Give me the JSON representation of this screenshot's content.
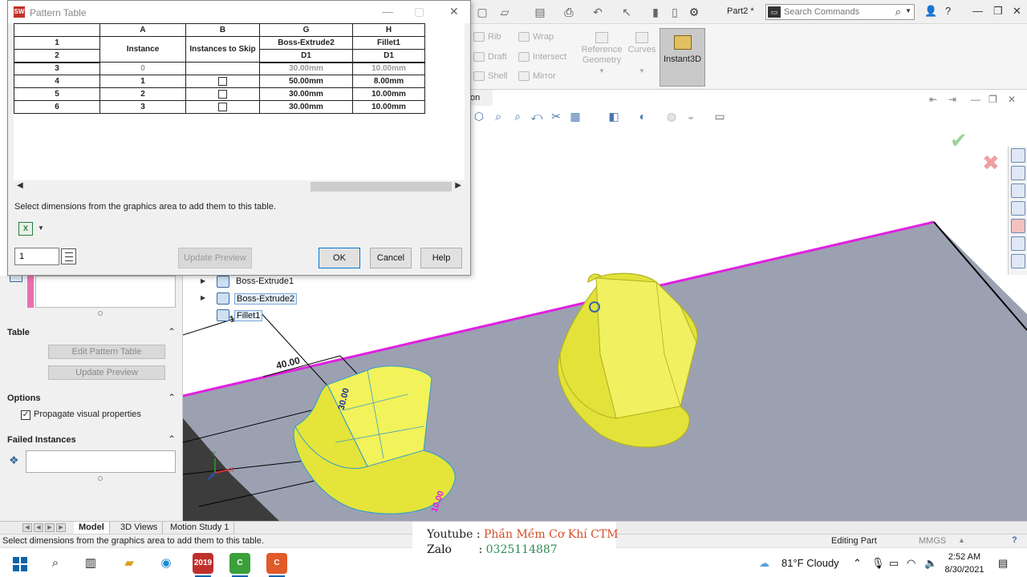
{
  "topbar": {
    "doc_title": "Part2 *",
    "search_placeholder": "Search Commands",
    "help_label": "?"
  },
  "ribbon": {
    "rib": "Rib",
    "wrap": "Wrap",
    "draft": "Draft",
    "intersect": "Intersect",
    "shell": "Shell",
    "mirror": "Mirror",
    "ref_geom_1": "Reference",
    "ref_geom_2": "Geometry",
    "curves": "Curves",
    "instant3d": "Instant3D"
  },
  "graphics": {
    "tab_fragment": "on",
    "dim_40": "40.00",
    "dim_vert": "30.00",
    "dim_fillet": "10.00",
    "dim_top": "10.00",
    "triad_x": "X",
    "triad_y": "Y",
    "tree": [
      {
        "label": "Boss-Extrude1"
      },
      {
        "label": "Boss-Extrude2"
      },
      {
        "label": "Fillet1"
      }
    ]
  },
  "dialog": {
    "title": "Pattern Table",
    "columns": [
      "A",
      "B",
      "G",
      "H"
    ],
    "row1_num": "1",
    "row2_num": "2",
    "col_instance": "Instance",
    "col_skip": "Instances to Skip",
    "col_g_name": "Boss-Extrude2",
    "col_g_dim": "D1",
    "col_h_name": "Fillet1",
    "col_h_dim": "D1",
    "rows": [
      {
        "num": "3",
        "instance": "0",
        "g": "30.00mm",
        "h": "10.00mm",
        "seed": true
      },
      {
        "num": "4",
        "instance": "1",
        "g": "50.00mm",
        "h": "8.00mm",
        "seed": false
      },
      {
        "num": "5",
        "instance": "2",
        "g": "30.00mm",
        "h": "10.00mm",
        "seed": false
      },
      {
        "num": "6",
        "instance": "3",
        "g": "30.00mm",
        "h": "10.00mm",
        "seed": false
      }
    ],
    "hint": "Select dimensions from the graphics area to add them to this table.",
    "spin_value": "1",
    "update_preview": "Update Preview",
    "ok": "OK",
    "cancel": "Cancel",
    "help": "Help"
  },
  "pm": {
    "table_header": "Table",
    "edit_pattern_table": "Edit Pattern Table",
    "update_preview": "Update Preview",
    "options_header": "Options",
    "propagate": "Propagate visual properties",
    "failed_header": "Failed Instances"
  },
  "bottom_tabs": [
    "Model",
    "3D Views",
    "Motion Study 1"
  ],
  "status": {
    "message": "Select dimensions from the graphics area to add them to this table.",
    "editing": "Editing Part",
    "units": "MMGS"
  },
  "overlay": {
    "youtube_key": "Youtube",
    "youtube_val": "Phần Mềm Cơ Khí CTM",
    "zalo_key": "Zalo",
    "zalo_val": "0325114887"
  },
  "taskbar": {
    "sw_label": "2019",
    "weather": "81°F  Cloudy",
    "time": "2:52 AM",
    "date": "8/30/2021"
  },
  "colors": {
    "accent": "#0078d7",
    "yellow_body": "#e8e830",
    "magenta_edge": "#e020e0",
    "plane": "#9a9fb0"
  }
}
